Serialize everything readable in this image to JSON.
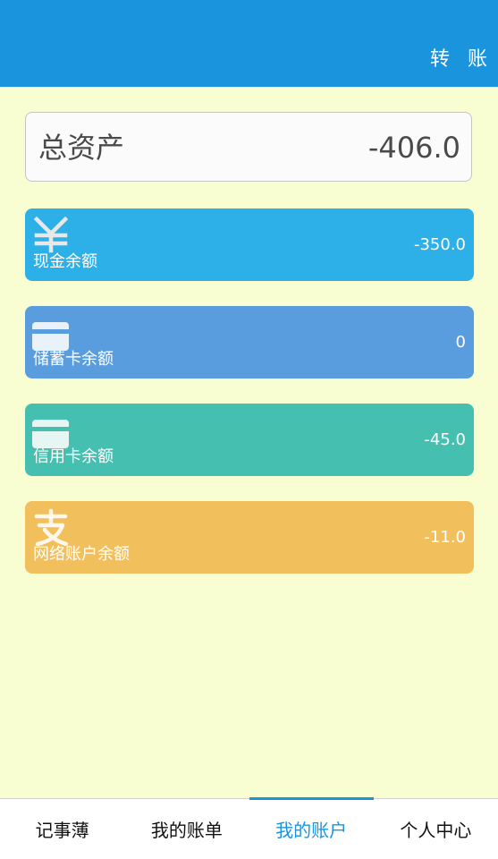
{
  "header": {
    "transfer_label": "转账",
    "color": "#1a94dc"
  },
  "total": {
    "label": "总资产",
    "value": "-406.0"
  },
  "accounts": [
    {
      "label": "现金余额",
      "value": "-350.0",
      "color": "#2db0e8",
      "icon": "yen-icon"
    },
    {
      "label": "储蓄卡余额",
      "value": "0",
      "color": "#5a9ddf",
      "icon": "card-icon"
    },
    {
      "label": "信用卡余额",
      "value": "-45.0",
      "color": "#45bfb0",
      "icon": "card-icon"
    },
    {
      "label": "网络账户余额",
      "value": "-11.0",
      "color": "#f1bf5c",
      "icon": "alipay-icon"
    }
  ],
  "nav": {
    "tabs": [
      {
        "label": "记事薄",
        "active": false
      },
      {
        "label": "我的账单",
        "active": false
      },
      {
        "label": "我的账户",
        "active": true
      },
      {
        "label": "个人中心",
        "active": false
      }
    ]
  }
}
